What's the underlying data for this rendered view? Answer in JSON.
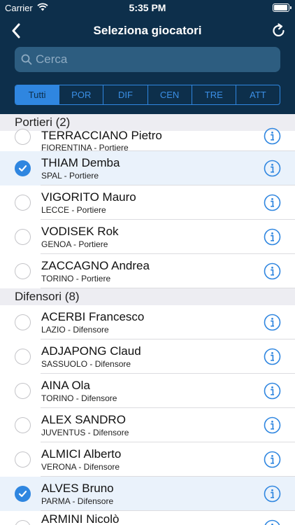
{
  "status": {
    "carrier": "Carrier",
    "time": "5:35 PM"
  },
  "nav": {
    "title": "Seleziona giocatori",
    "back_icon": "chevron-left-icon",
    "refresh_icon": "refresh-icon"
  },
  "search": {
    "placeholder": "Cerca",
    "value": ""
  },
  "filters": [
    {
      "label": "Tutti",
      "active": true
    },
    {
      "label": "POR",
      "active": false
    },
    {
      "label": "DIF",
      "active": false
    },
    {
      "label": "CEN",
      "active": false
    },
    {
      "label": "TRE",
      "active": false
    },
    {
      "label": "ATT",
      "active": false
    }
  ],
  "colors": {
    "header_bg": "#0d2f4b",
    "accent": "#2f86e0",
    "selected_row": "#eaf2fb"
  },
  "sections": [
    {
      "title": "Portieri (2)",
      "players": [
        {
          "name": "TERRACCIANO Pietro",
          "team": "FIORENTINA - Portiere",
          "selected": false
        },
        {
          "name": "THIAM Demba",
          "team": "SPAL - Portiere",
          "selected": true
        },
        {
          "name": "VIGORITO Mauro",
          "team": "LECCE - Portiere",
          "selected": false
        },
        {
          "name": "VODISEK Rok",
          "team": "GENOA - Portiere",
          "selected": false
        },
        {
          "name": "ZACCAGNO Andrea",
          "team": "TORINO - Portiere",
          "selected": false
        }
      ]
    },
    {
      "title": "Difensori (8)",
      "players": [
        {
          "name": "ACERBI Francesco",
          "team": "LAZIO - Difensore",
          "selected": false
        },
        {
          "name": "ADJAPONG Claud",
          "team": "SASSUOLO - Difensore",
          "selected": false
        },
        {
          "name": "AINA Ola",
          "team": "TORINO - Difensore",
          "selected": false
        },
        {
          "name": "ALEX SANDRO",
          "team": "JUVENTUS - Difensore",
          "selected": false
        },
        {
          "name": "ALMICI Alberto",
          "team": "VERONA - Difensore",
          "selected": false
        },
        {
          "name": "ALVES Bruno",
          "team": "PARMA - Difensore",
          "selected": true
        },
        {
          "name": "ARMINI Nicolò",
          "team": "",
          "selected": false
        }
      ]
    }
  ]
}
